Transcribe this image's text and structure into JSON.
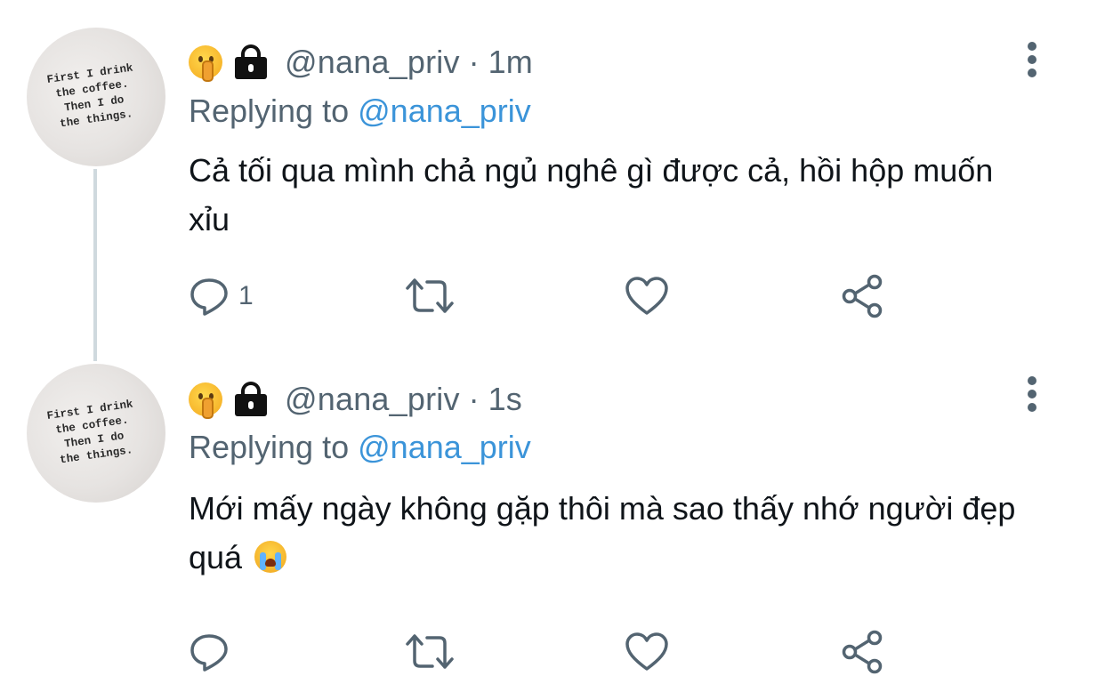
{
  "tweets": [
    {
      "avatar_text": "First I drink\nthe coffee.\nThen I do\nthe things.",
      "handle": "@nana_priv",
      "separator": "·",
      "time": "1m",
      "replying_prefix": "Replying to",
      "replying_to": "@nana_priv",
      "text": "Cả tối qua mình chả ngủ nghê gì được cả, hồi hộp muốn xỉu",
      "text_emoji": "",
      "reply_count": "1",
      "icons": [
        "shushing-face-emoji",
        "lock-icon",
        "more-options-icon",
        "reply-icon",
        "retweet-icon",
        "like-icon",
        "share-icon"
      ]
    },
    {
      "avatar_text": "First I drink\nthe coffee.\nThen I do\nthe things.",
      "handle": "@nana_priv",
      "separator": "·",
      "time": "1s",
      "replying_prefix": "Replying to",
      "replying_to": "@nana_priv",
      "text": "Mới mấy ngày không gặp thôi mà sao thấy nhớ người đẹp quá",
      "text_emoji": "loudly-crying-face",
      "reply_count": "",
      "icons": [
        "shushing-face-emoji",
        "lock-icon",
        "more-options-icon",
        "reply-icon",
        "retweet-icon",
        "like-icon",
        "share-icon"
      ]
    }
  ],
  "colors": {
    "secondary_text": "#536471",
    "link": "#3b94d9",
    "thread_line": "#cfd9de"
  }
}
